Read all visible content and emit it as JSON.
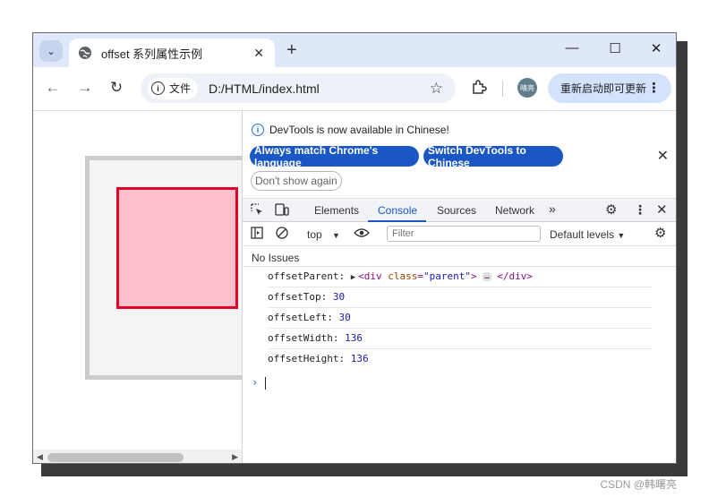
{
  "browser": {
    "tab_title": "offset 系列属性示例",
    "address_chip": "文件",
    "url": "D:/HTML/index.html",
    "avatar_text": "晴亮",
    "update_button": "重新启动即可更新"
  },
  "devtools": {
    "info_message": "DevTools is now available in Chinese!",
    "btn_match_language": "Always match Chrome's language",
    "btn_switch_chinese": "Switch DevTools to Chinese",
    "btn_dont_show": "Don't show again",
    "tabs": [
      "Elements",
      "Console",
      "Sources",
      "Network"
    ],
    "more_tabs": "»",
    "context": "top",
    "filter_placeholder": "Filter",
    "levels": "Default levels",
    "issues": "No Issues",
    "logs": {
      "parent_label": "offsetParent: ",
      "parent_open_tag": "<div ",
      "parent_attr": "class",
      "parent_eq": "=",
      "parent_val": "\"parent\"",
      "parent_gt": ">",
      "parent_ellipsis": "…",
      "parent_close": "</div>",
      "top_label": "offsetTop: ",
      "top_value": "30",
      "left_label": "offsetLeft: ",
      "left_value": "30",
      "width_label": "offsetWidth: ",
      "width_value": "136",
      "height_label": "offsetHeight: ",
      "height_value": "136"
    }
  },
  "watermark": "CSDN @韩曙亮",
  "colors": {
    "accent": "#1a56c4",
    "child_fill": "#ffc0cb",
    "child_border": "#e00028",
    "parent_fill": "#f4f4f4",
    "parent_border": "#cccccc"
  }
}
